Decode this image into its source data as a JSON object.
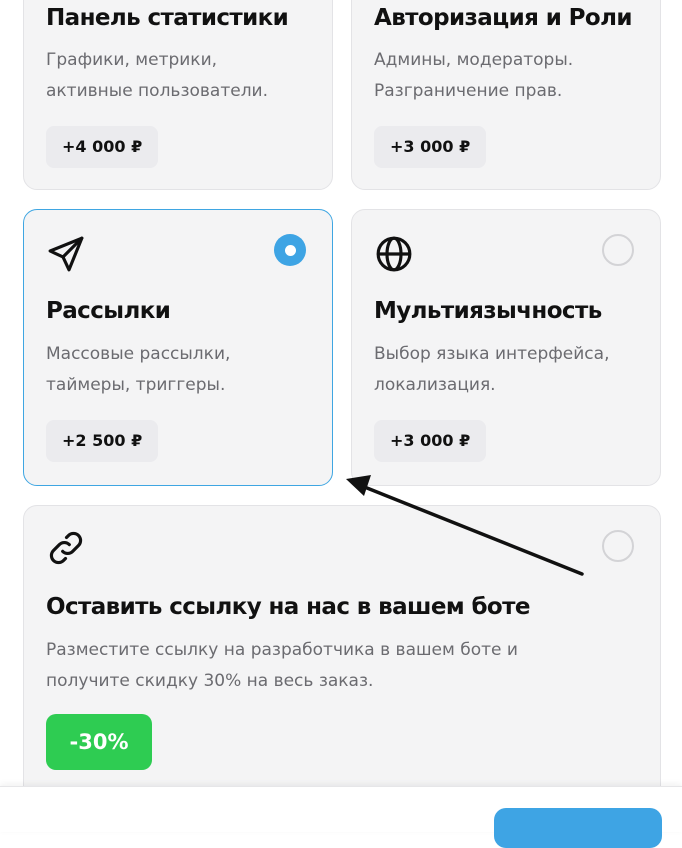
{
  "cards": [
    {
      "id": "stats",
      "title": "Панель статистики",
      "desc_line1": "Графики, метрики,",
      "desc_line2": "активные пользователи.",
      "price": "+4 000 ₽"
    },
    {
      "id": "auth",
      "title": "Авторизация и Роли",
      "desc_line1": "Админы, модераторы.",
      "desc_line2": "Разграничение прав.",
      "price": "+3 000 ₽"
    },
    {
      "id": "mailing",
      "title": "Рассылки",
      "desc_line1": "Массовые рассылки,",
      "desc_line2": "таймеры, триггеры.",
      "price": "+2 500 ₽",
      "icon": "send-icon",
      "selected": true
    },
    {
      "id": "multilang",
      "title": "Мультиязычность",
      "desc_line1": "Выбор языка интерфейса,",
      "desc_line2": "локализация.",
      "price": "+3 000 ₽",
      "icon": "globe-icon",
      "selected": false
    },
    {
      "id": "link",
      "title": "Оставить ссылку на нас в вашем боте",
      "desc_line1": "Разместите ссылку на разработчика в вашем боте и",
      "desc_line2": "получите скидку 30% на весь заказ.",
      "badge": "-30%",
      "icon": "link-icon",
      "selected": false
    }
  ],
  "colors": {
    "accent": "#3ea4e4",
    "discount": "#2ecc52",
    "card_bg": "#f4f4f5"
  }
}
